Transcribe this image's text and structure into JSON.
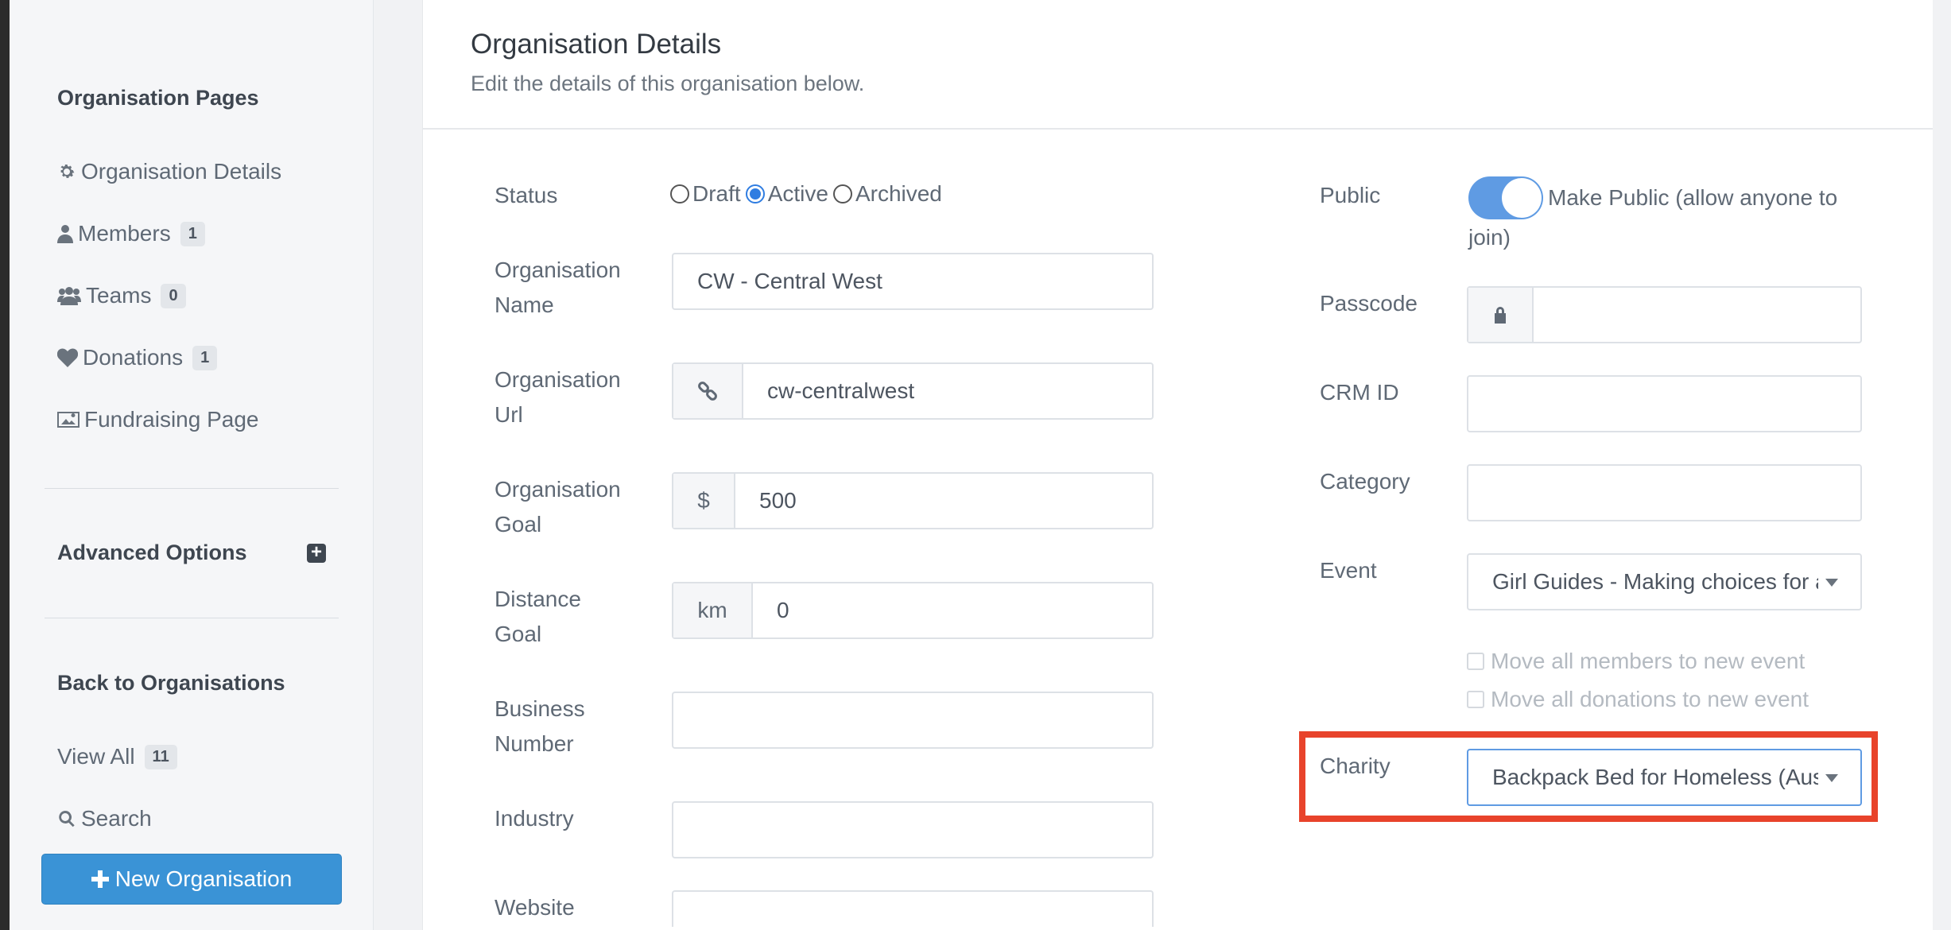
{
  "sidebar": {
    "org_pages_heading": "Organisation Pages",
    "items": [
      {
        "label": "Organisation Details",
        "icon": "gear-icon"
      },
      {
        "label": "Members",
        "icon": "user-icon",
        "badge": "1"
      },
      {
        "label": "Teams",
        "icon": "users-icon",
        "badge": "0"
      },
      {
        "label": "Donations",
        "icon": "heart-icon",
        "badge": "1"
      },
      {
        "label": "Fundraising Page",
        "icon": "image-icon"
      }
    ],
    "advanced_heading": "Advanced Options",
    "back_heading": "Back to Organisations",
    "view_all": {
      "label": "View All",
      "badge": "11"
    },
    "search_label": "Search",
    "new_org_label": "New Organisation"
  },
  "header": {
    "title": "Organisation Details",
    "subtitle": "Edit the details of this organisation below."
  },
  "form": {
    "status": {
      "label": "Status",
      "options": [
        "Draft",
        "Active",
        "Archived"
      ],
      "selected": "Active"
    },
    "org_name": {
      "label_line1": "Organisation",
      "label_line2": "Name",
      "value": "CW - Central West"
    },
    "org_url": {
      "label_line1": "Organisation",
      "label_line2": "Url",
      "value": "cw-centralwest"
    },
    "org_goal": {
      "label_line1": "Organisation",
      "label_line2": "Goal",
      "addon": "$",
      "value": "500"
    },
    "distance_goal": {
      "label_line1": "Distance",
      "label_line2": "Goal",
      "addon": "km",
      "value": "0"
    },
    "business_number": {
      "label_line1": "Business",
      "label_line2": "Number",
      "value": ""
    },
    "industry": {
      "label": "Industry",
      "value": ""
    },
    "website": {
      "label": "Website",
      "value": ""
    },
    "public": {
      "label": "Public",
      "toggle_text": "Make Public (allow anyone to join)",
      "enabled": true
    },
    "passcode": {
      "label": "Passcode",
      "value": ""
    },
    "crm_id": {
      "label": "CRM ID",
      "value": ""
    },
    "category": {
      "label": "Category",
      "value": ""
    },
    "event": {
      "label": "Event",
      "value": "Girl Guides - Making choices for a"
    },
    "move_members": "Move all members to new event",
    "move_donations": "Move all donations to new event",
    "charity": {
      "label": "Charity",
      "value": "Backpack Bed for Homeless (Aus"
    }
  },
  "colors": {
    "primary": "#3a93d6",
    "toggle": "#5f9be3",
    "highlight": "#e8432b"
  }
}
